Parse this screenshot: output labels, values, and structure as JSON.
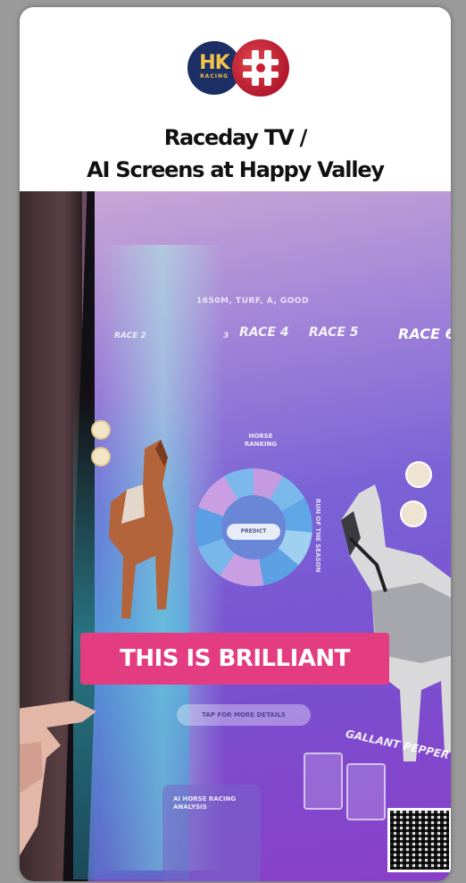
{
  "header": {
    "logo_text": "HK",
    "logo_subtext": "RACING",
    "title_line1": "Raceday TV /",
    "title_line2": "AI Screens at Happy Valley"
  },
  "screen": {
    "race_info": "1650M, TURF, A, GOOD",
    "tabs": [
      {
        "label": "RACE 2"
      },
      {
        "label": "3"
      },
      {
        "label": "RACE 4"
      },
      {
        "label": "RACE 5"
      },
      {
        "label": "RACE 6"
      }
    ],
    "ring_label": "HORSE RANKING",
    "ring_center": "PREDICT",
    "stats_label": "RUN OF THE SEASON",
    "horse_name": "GALLANT PEPPER",
    "pill_text": "TAP FOR MORE DETAILS",
    "bottom_card_text": "AI HORSE RACING ANALYSIS"
  },
  "overlay": {
    "caption": "THIS IS BRILLIANT",
    "caption_color": "#e43c80"
  },
  "colors": {
    "screen_accent": "#7a4fd0",
    "logo_navy": "#1c2f64",
    "logo_red": "#c8202f"
  }
}
